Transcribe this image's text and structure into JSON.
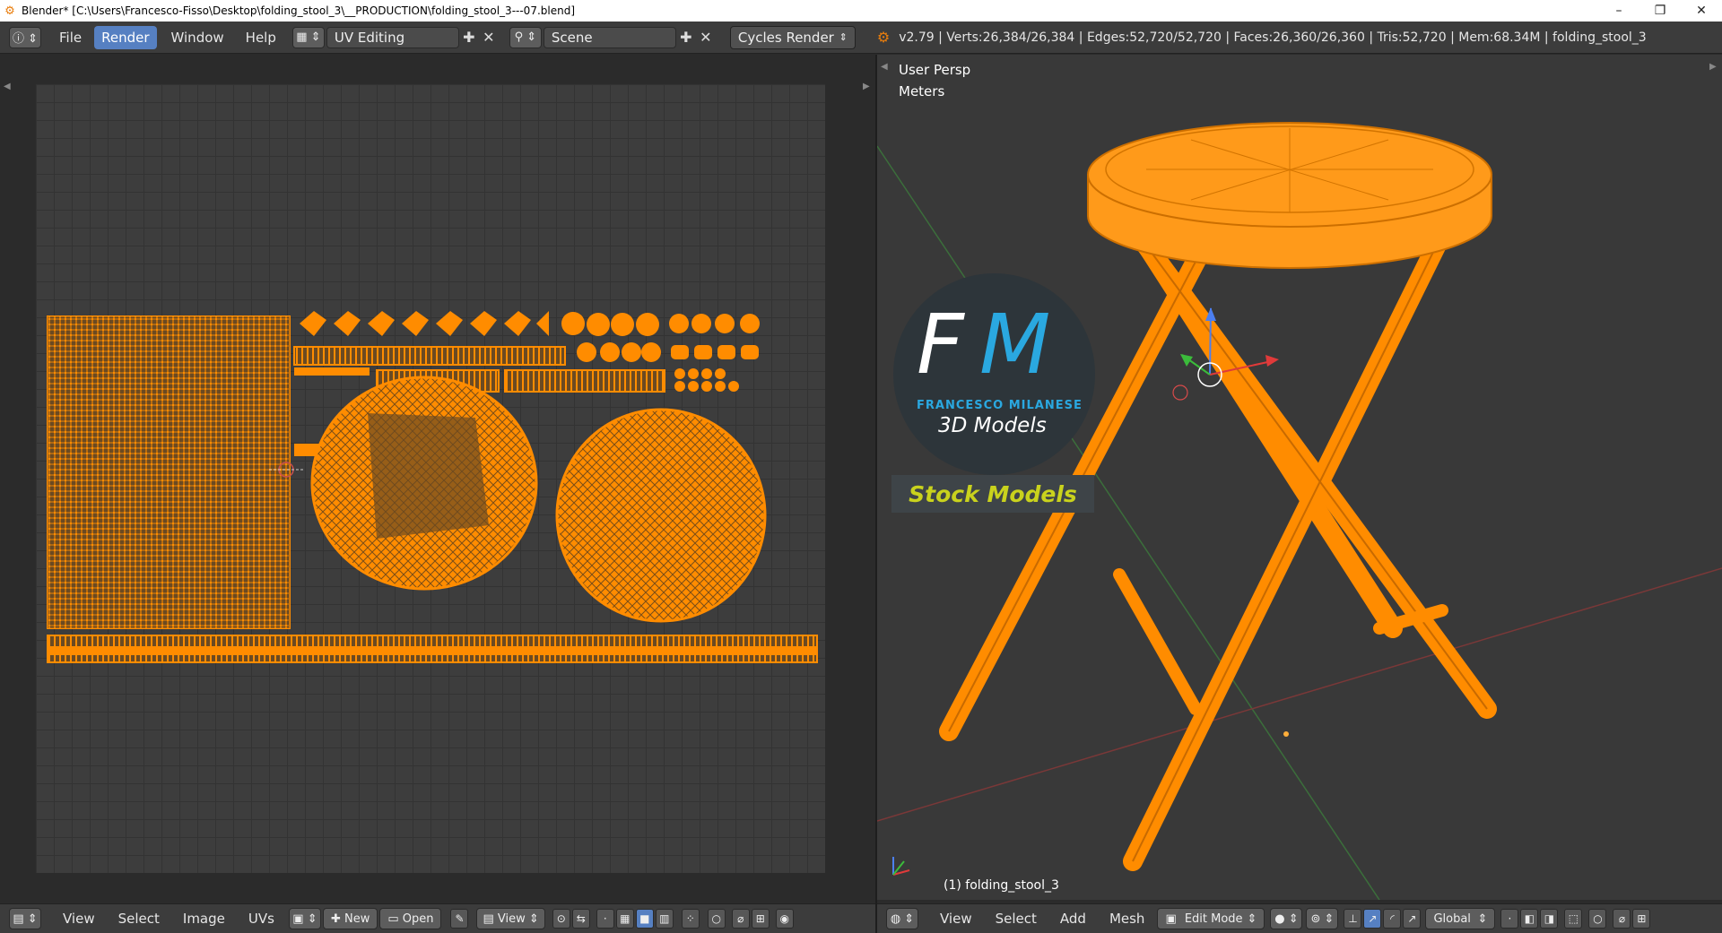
{
  "window": {
    "title": "Blender* [C:\\Users\\Francesco-Fisso\\Desktop\\folding_stool_3\\__PRODUCTION\\folding_stool_3---07.blend]",
    "minimize": "–",
    "maximize": "❐",
    "close": "✕"
  },
  "topbar": {
    "menu": [
      "File",
      "Render",
      "Window",
      "Help"
    ],
    "active_menu": "Render",
    "screen_layout": "UV Editing",
    "scene": "Scene",
    "render_engine": "Cycles Render",
    "stats": "v2.79 | Verts:26,384/26,384 | Edges:52,720/52,720 | Faces:26,360/26,360 | Tris:52,720 | Mem:68.34M | folding_stool_3"
  },
  "viewport": {
    "view_name": "User Persp",
    "units": "Meters",
    "object_label": "(1) folding_stool_3"
  },
  "logo": {
    "letters_f": "F",
    "letters_m": "M",
    "brand": "FRANCESCO MILANESE",
    "subtitle": "3D Models",
    "badge": "Stock Models"
  },
  "uv_bottombar": {
    "items": [
      "View",
      "Select",
      "Image",
      "UVs"
    ],
    "new_label": "New",
    "open_label": "Open",
    "view_label": "View"
  },
  "view3d_bottombar": {
    "items": [
      "View",
      "Select",
      "Add",
      "Mesh"
    ],
    "mode": "Edit Mode",
    "orientation": "Global"
  },
  "colors": {
    "accent": "#ff8c00",
    "selection_blue": "#5680c2",
    "logo_blue": "#2aa8e0",
    "badge_yellow": "#c9d21d"
  }
}
